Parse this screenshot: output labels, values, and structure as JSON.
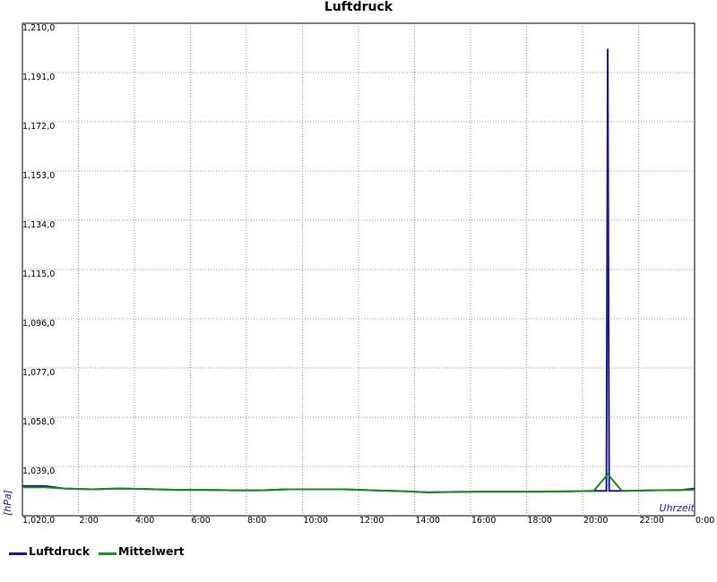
{
  "chart_data": {
    "type": "line",
    "title": "Luftdruck",
    "ylabel": "[hPa]",
    "xlabel": "Uhrzeit",
    "ylim": [
      1020.0,
      1210.0
    ],
    "xlim": [
      0,
      24
    ],
    "yticks": [
      "1,020,0",
      "1,039,0",
      "1,058,0",
      "1,077,0",
      "1,096,0",
      "1,115,0",
      "1,134,0",
      "1,153,0",
      "1,172,0",
      "1,191,0",
      "1,210,0"
    ],
    "xticks": [
      "2:00",
      "4:00",
      "6:00",
      "8:00",
      "10:00",
      "12:00",
      "14:00",
      "16:00",
      "18:00",
      "20:00",
      "22:00",
      "0:00"
    ],
    "grid": true,
    "legend_position": "bottom-left",
    "series": [
      {
        "name": "Luftdruck",
        "color": "#1a1a8c",
        "x": [
          0,
          0.8,
          1.5,
          2.5,
          3.5,
          4.5,
          5.5,
          6.5,
          7.5,
          8.5,
          9.5,
          10.5,
          11.5,
          12.5,
          13.5,
          14.5,
          15.5,
          16.5,
          17.5,
          18.5,
          19.5,
          20.5,
          20.85,
          20.9,
          20.95,
          21.5,
          22.5,
          23.5,
          24
        ],
        "values": [
          1031.5,
          1031.5,
          1030.5,
          1030.2,
          1030.5,
          1030.3,
          1030.0,
          1030.0,
          1029.8,
          1029.8,
          1030.2,
          1030.2,
          1030.2,
          1029.8,
          1029.5,
          1029.0,
          1029.2,
          1029.3,
          1029.3,
          1029.3,
          1029.4,
          1029.6,
          1029.6,
          1200.0,
          1029.6,
          1029.6,
          1029.8,
          1029.9,
          1030.5
        ]
      },
      {
        "name": "Mittelwert",
        "color": "#1e8c1e",
        "x": [
          0,
          0.8,
          1.5,
          2.5,
          3.5,
          4.5,
          5.5,
          6.5,
          7.5,
          8.5,
          9.5,
          10.5,
          11.5,
          12.5,
          13.5,
          14.5,
          15.5,
          16.5,
          17.5,
          18.5,
          19.5,
          20.4,
          20.9,
          21.4,
          22.5,
          23.5,
          24
        ],
        "values": [
          1031.0,
          1031.0,
          1030.5,
          1030.2,
          1030.5,
          1030.3,
          1030.0,
          1030.0,
          1029.8,
          1029.8,
          1030.2,
          1030.2,
          1030.2,
          1029.8,
          1029.5,
          1029.0,
          1029.2,
          1029.3,
          1029.3,
          1029.3,
          1029.4,
          1029.6,
          1036.0,
          1029.6,
          1029.8,
          1029.9,
          1030.0
        ]
      }
    ]
  }
}
